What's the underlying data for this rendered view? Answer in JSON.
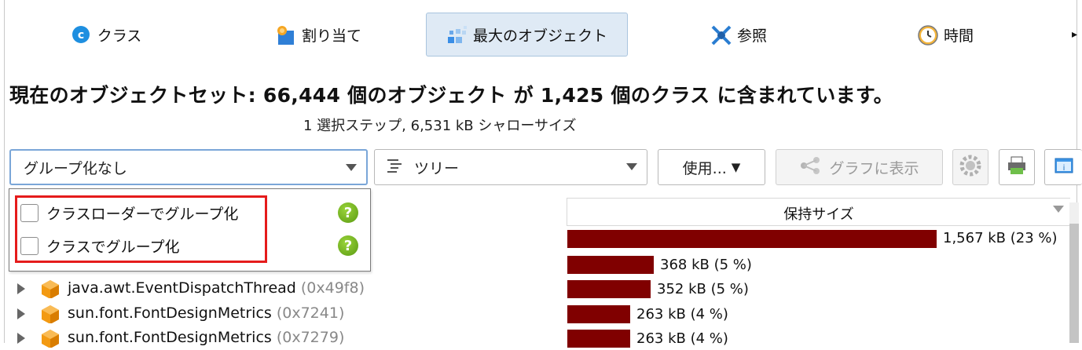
{
  "tabs": [
    {
      "label": "クラス",
      "icon": "class-c-icon"
    },
    {
      "label": "割り当て",
      "icon": "allocation-icon"
    },
    {
      "label": "最大のオブジェクト",
      "icon": "biggest-objects-icon",
      "active": true
    },
    {
      "label": "参照",
      "icon": "references-icon"
    },
    {
      "label": "時間",
      "icon": "clock-icon"
    }
  ],
  "tabs_scroll": "▸",
  "headline": "現在のオブジェクトセット:  66,444 個のオブジェクト が 1,425 個のクラス に含まれています。",
  "subline": "1 選択ステップ, 6,531 kB シャローサイズ",
  "toolbar": {
    "grouping_value": "グループ化なし",
    "view_value": "ツリー",
    "use_label": "使用...",
    "use_caret": "▼",
    "graph_label": "グラフに表示"
  },
  "popup": {
    "options": [
      {
        "label": "クラスローダーでグループ化",
        "checked": false
      },
      {
        "label": "クラスでグループ化",
        "checked": false
      }
    ],
    "help_glyph": "?"
  },
  "table": {
    "retained_header": "保持サイズ",
    "rows": [
      {
        "name": "",
        "addr": "",
        "size_label": "1,567 kB (23 %)",
        "fraction": 0.23
      },
      {
        "name": "",
        "addr": "",
        "size_label": "368 kB (5 %)",
        "fraction": 0.054
      },
      {
        "name": "java.awt.EventDispatchThread",
        "addr": "(0x49f8)",
        "size_label": "352 kB (5 %)",
        "fraction": 0.052
      },
      {
        "name": "sun.font.FontDesignMetrics",
        "addr": "(0x7241)",
        "size_label": "263 kB (4 %)",
        "fraction": 0.039
      },
      {
        "name": "sun.font.FontDesignMetrics",
        "addr": "(0x7279)",
        "size_label": "263 kB (4 %)",
        "fraction": 0.039
      }
    ]
  },
  "colors": {
    "bar": "#800000",
    "active_tab_bg": "#dfeaf5",
    "highlight_box": "#e51b1b",
    "help_green": "#6aa91a",
    "cube_orange": "#f39a12"
  }
}
